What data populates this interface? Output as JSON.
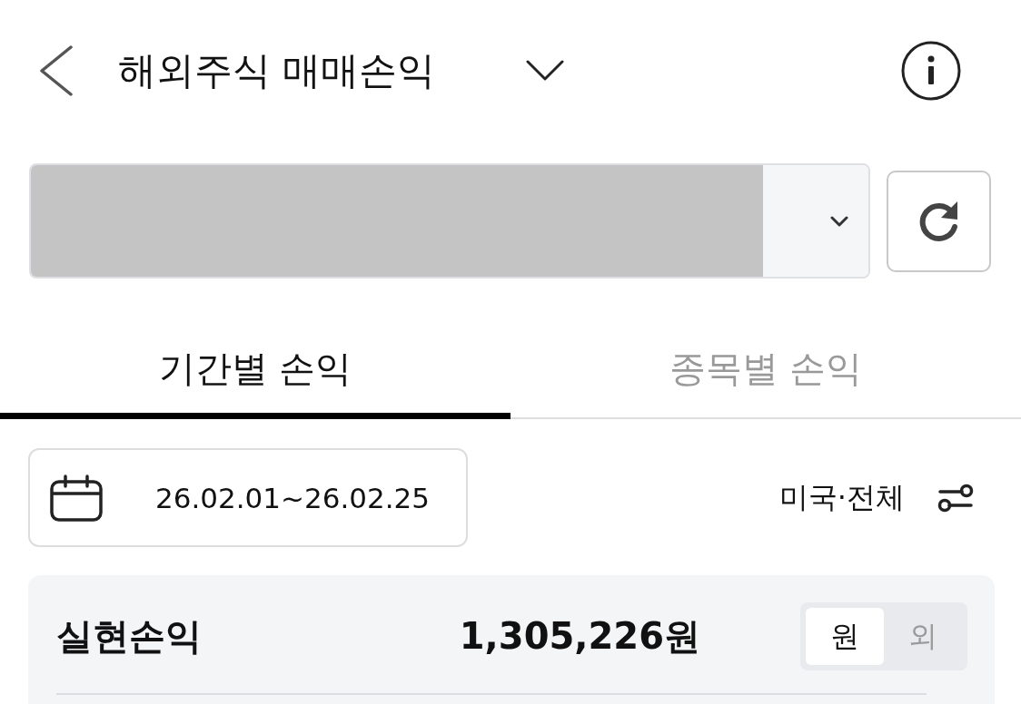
{
  "header": {
    "title": "해외주식 매매손익"
  },
  "tabs": [
    {
      "label": "기간별 손익",
      "selected": true
    },
    {
      "label": "종목별 손익",
      "selected": false
    }
  ],
  "filters": {
    "date_range": "26.02.01~26.02.25",
    "market": "미국·전체"
  },
  "summary": {
    "label": "실현손익",
    "value": "1,305,226원",
    "currency_toggle": [
      {
        "label": "원",
        "selected": true
      },
      {
        "label": "외",
        "selected": false
      }
    ]
  }
}
